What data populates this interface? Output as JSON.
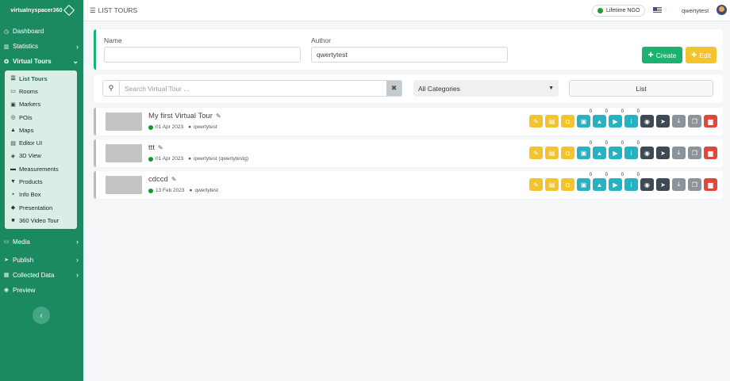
{
  "brand": {
    "name": "virtualnyspacer360"
  },
  "sidebar": {
    "items": [
      {
        "label": "Dashboard",
        "icon": "dashboard-icon"
      },
      {
        "label": "Statistics",
        "icon": "chart-icon"
      },
      {
        "label": "Virtual Tours",
        "icon": "globe-icon"
      }
    ],
    "sub_items": [
      {
        "label": "List Tours",
        "icon": "list-icon"
      },
      {
        "label": "Rooms",
        "icon": "room-icon"
      },
      {
        "label": "Markers",
        "icon": "marker-icon"
      },
      {
        "label": "POIs",
        "icon": "poi-icon"
      },
      {
        "label": "Maps",
        "icon": "map-icon"
      },
      {
        "label": "Editor UI",
        "icon": "editor-icon"
      },
      {
        "label": "3D View",
        "icon": "cube-icon"
      },
      {
        "label": "Measurements",
        "icon": "ruler-icon"
      },
      {
        "label": "Products",
        "icon": "cart-icon"
      },
      {
        "label": "Info Box",
        "icon": "info-icon"
      },
      {
        "label": "Presentation",
        "icon": "presentation-icon"
      },
      {
        "label": "360 Video Tour",
        "icon": "video-icon"
      }
    ],
    "bottom_items": [
      {
        "label": "Media",
        "icon": "media-icon"
      },
      {
        "label": "Publish",
        "icon": "send-icon"
      },
      {
        "label": "Collected Data",
        "icon": "database-icon"
      },
      {
        "label": "Preview",
        "icon": "eye-icon"
      }
    ]
  },
  "topbar": {
    "title": "LIST TOURS",
    "plan": "Lifetime NGO",
    "username": "qwertytest"
  },
  "filters": {
    "name_label": "Name",
    "name_value": "",
    "author_label": "Author",
    "author_value": "qwertytest",
    "create_label": "Create",
    "edit_label": "Edit"
  },
  "search": {
    "placeholder": "Search Virtual Tour ...",
    "category": "All Categories",
    "view_mode": "List"
  },
  "tours": [
    {
      "name": "My first Virtual Tour",
      "date": "01 Apr 2023",
      "author": "qwertytest",
      "counts": [
        "0",
        "0",
        "0",
        "0"
      ]
    },
    {
      "name": "ttt",
      "date": "01 Apr 2023",
      "author": "qwertytest (qwertytestg)",
      "counts": [
        "0",
        "0",
        "0",
        "0"
      ]
    },
    {
      "name": "cdccd",
      "date": "13 Feb 2023",
      "author": "qwertytest",
      "counts": [
        "0",
        "0",
        "0",
        "0"
      ]
    }
  ],
  "colors": {
    "sidebar": "#1b8a61",
    "accent_green": "#1bb36f",
    "accent_yellow": "#f4c330",
    "accent_teal": "#27b2c2",
    "danger": "#e0493a"
  }
}
